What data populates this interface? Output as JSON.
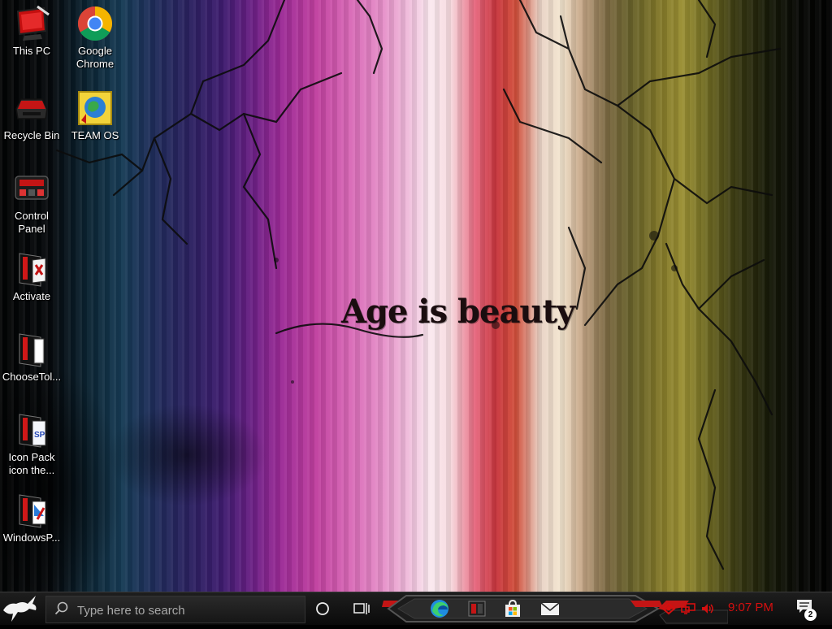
{
  "wallpaper": {
    "text": "Age is beauty"
  },
  "desktop_icons": [
    {
      "label": "This PC",
      "icon": "this-pc-icon"
    },
    {
      "label": "Google Chrome",
      "icon": "chrome-icon"
    },
    {
      "label": "Recycle Bin",
      "icon": "recycle-bin-icon"
    },
    {
      "label": "TEAM OS",
      "icon": "team-os-icon"
    },
    {
      "label": "Control Panel",
      "icon": "control-panel-icon"
    },
    {
      "label": "Activate",
      "icon": "activate-icon"
    },
    {
      "label": "ChooseTol...",
      "icon": "choose-tool-icon"
    },
    {
      "label": "Icon Pack icon the...",
      "icon": "icon-pack-icon"
    },
    {
      "label": "WindowsP...",
      "icon": "windows-p-icon"
    }
  ],
  "taskbar": {
    "search_placeholder": "Type here to search",
    "clock": "9:07 PM",
    "notification_count": "2",
    "pinned": [
      "edge-icon",
      "red-black-app-icon",
      "store-icon",
      "mail-icon"
    ],
    "accent_color": "#d40f0f"
  }
}
